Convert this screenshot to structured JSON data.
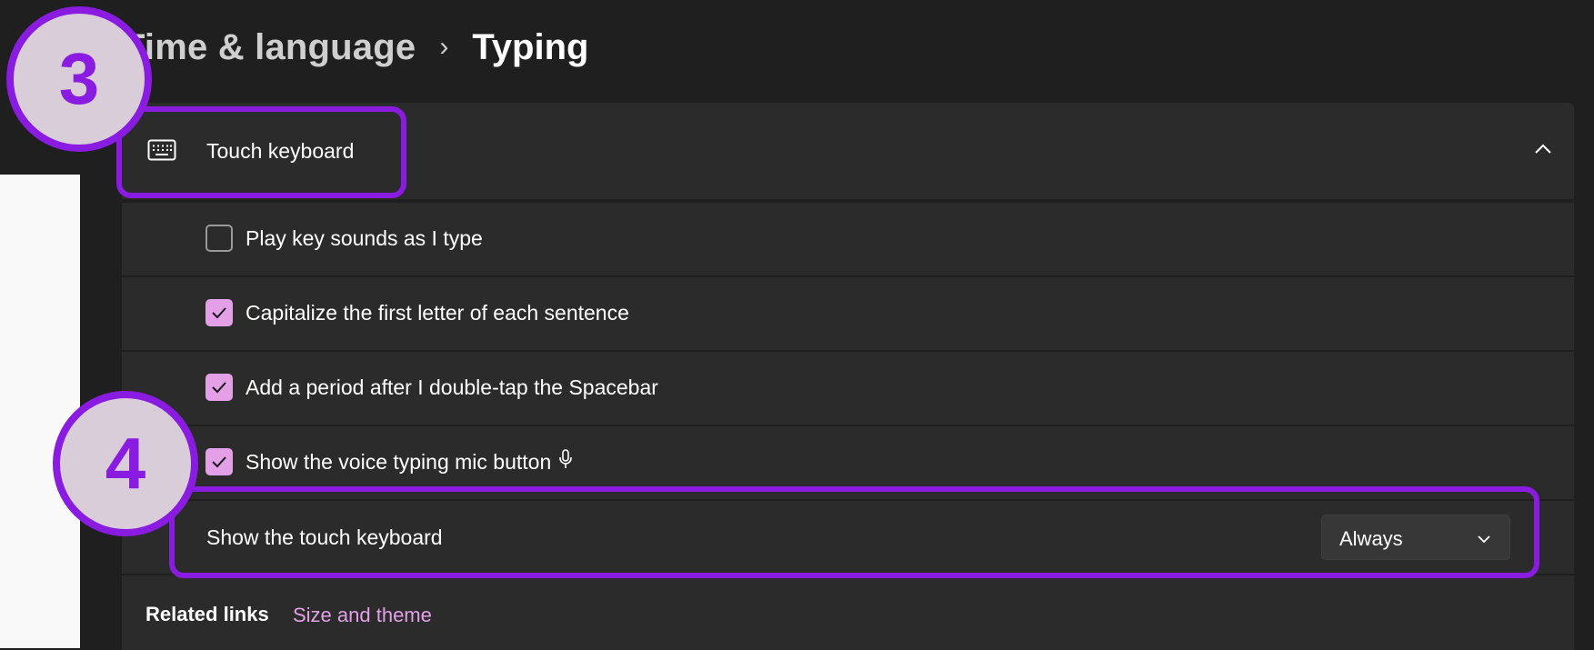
{
  "breadcrumb": {
    "parent": "Time & language",
    "separator": "›",
    "current": "Typing"
  },
  "touch_keyboard": {
    "label": "Touch keyboard",
    "icon": "keyboard-icon",
    "expanded": true
  },
  "options": [
    {
      "label": "Play key sounds as I type",
      "checked": false
    },
    {
      "label": "Capitalize the first letter of each sentence",
      "checked": true
    },
    {
      "label": "Add a period after I double-tap the Spacebar",
      "checked": true
    },
    {
      "label": "Show the voice typing mic button",
      "checked": true,
      "icon": "microphone-icon"
    }
  ],
  "show_touch_keyboard": {
    "label": "Show the touch keyboard",
    "selected": "Always"
  },
  "related": {
    "label": "Related links",
    "link": "Size and theme"
  },
  "annotations": [
    {
      "number": "3"
    },
    {
      "number": "4"
    }
  ],
  "colors": {
    "accent": "#e3a0e6",
    "annotation": "#8a1be0",
    "badge_fill": "#d9cdd9",
    "card": "#2b2b2b",
    "background": "#1f1f1f"
  }
}
